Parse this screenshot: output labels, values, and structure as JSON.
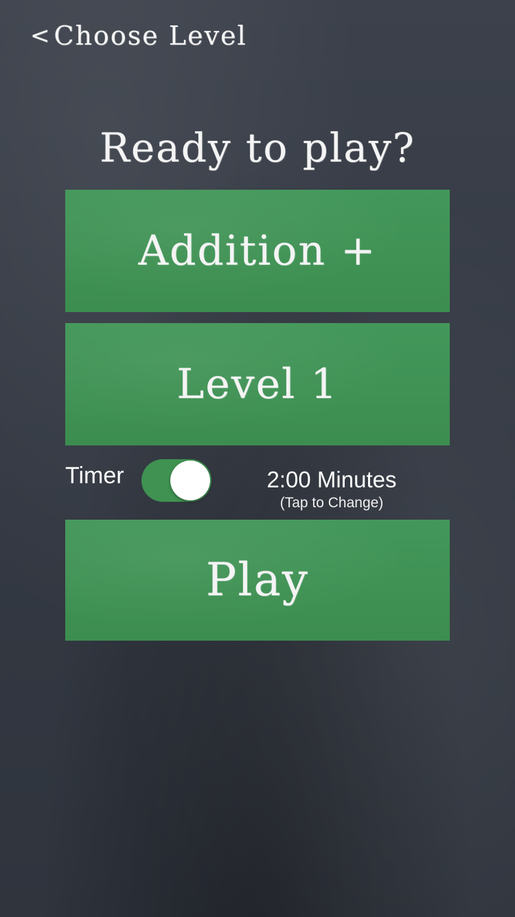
{
  "nav": {
    "back_chevron": "<",
    "back_label": "Choose Level"
  },
  "title": "Ready to play?",
  "operation": {
    "label": "Addition +"
  },
  "level": {
    "label": "Level 1"
  },
  "timer": {
    "label": "Timer",
    "enabled": true,
    "duration": "2:00 Minutes",
    "hint": "(Tap to Change)"
  },
  "play": {
    "label": "Play"
  },
  "colors": {
    "background": "#363b45",
    "button_green": "#3f9251",
    "text": "#ffffff"
  }
}
